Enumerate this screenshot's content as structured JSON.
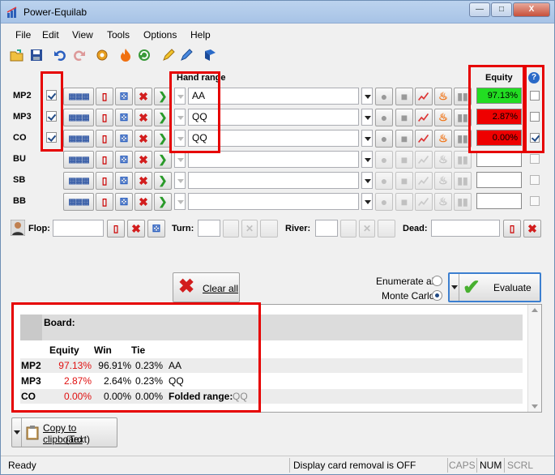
{
  "window": {
    "title": "Power-Equilab",
    "btn_minimize": "—",
    "btn_restore": "□",
    "btn_close": "X"
  },
  "menu": [
    "File",
    "Edit",
    "View",
    "Tools",
    "Options",
    "Help"
  ],
  "headers": {
    "hand_range": "Hand range",
    "equity": "Equity",
    "help": "?"
  },
  "players": [
    {
      "pos": "MP2",
      "checked": true,
      "range": "AA",
      "equity": "97.13%",
      "eq_color": "#22dd22",
      "right_checked": false
    },
    {
      "pos": "MP3",
      "checked": true,
      "range": "QQ",
      "equity": "2.87%",
      "eq_color": "#ee0000",
      "right_checked": false
    },
    {
      "pos": "CO",
      "checked": true,
      "range": "QQ",
      "equity": "0.00%",
      "eq_color": "#ee0000",
      "right_checked": true
    },
    {
      "pos": "BU",
      "checked": false,
      "range": "",
      "equity": "",
      "eq_color": "#ffffff",
      "right_checked": false
    },
    {
      "pos": "SB",
      "checked": false,
      "range": "",
      "equity": "",
      "eq_color": "#ffffff",
      "right_checked": false
    },
    {
      "pos": "BB",
      "checked": false,
      "range": "",
      "equity": "",
      "eq_color": "#ffffff",
      "right_checked": false
    }
  ],
  "board_row": {
    "flop": "Flop:",
    "turn": "Turn:",
    "river": "River:",
    "dead": "Dead:"
  },
  "actions": {
    "clear_all": "Clear all",
    "enumerate_all": "Enumerate all",
    "monte_carlo": "Monte Carlo",
    "evaluate": "Evaluate",
    "selected_mode": "monte_carlo"
  },
  "results": {
    "board_label": "Board:",
    "columns": [
      "Equity",
      "Win",
      "Tie"
    ],
    "rows": [
      {
        "pos": "MP2",
        "equity": "97.13%",
        "win": "96.91%",
        "tie": "0.23%",
        "hand": "AA",
        "folded": ""
      },
      {
        "pos": "MP3",
        "equity": "2.87%",
        "win": "2.64%",
        "tie": "0.23%",
        "hand": "QQ",
        "folded": ""
      },
      {
        "pos": "CO",
        "equity": "0.00%",
        "win": "0.00%",
        "tie": "0.00%",
        "hand": "Folded range:",
        "folded": "QQ"
      }
    ]
  },
  "copy": {
    "line1": "Copy to clipboard",
    "line2": "(Text)"
  },
  "status": {
    "ready": "Ready",
    "card_removal": "Display card removal is OFF",
    "caps": "CAPS",
    "num": "NUM",
    "scrl": "SCRL"
  },
  "colors": {
    "highlight": "#e60000",
    "equity_green": "#22dd22",
    "equity_red": "#ee0000"
  }
}
